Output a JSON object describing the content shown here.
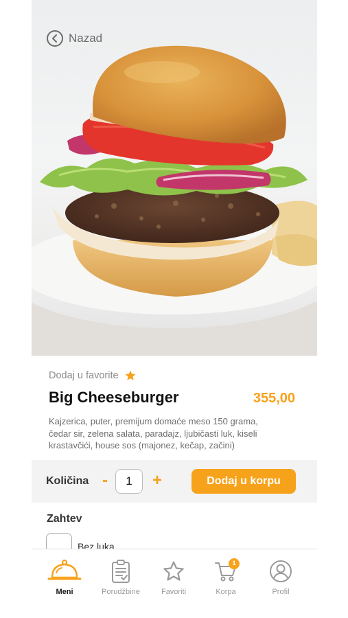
{
  "header": {
    "back_label": "Nazad"
  },
  "product": {
    "favorite_label": "Dodaj u favorite",
    "name": "Big Cheeseburger",
    "price": "355,00",
    "description": "Kajzerica, puter, premijum domaće meso 150 grama, čedar sir, zelena salata, paradajz, ljubičasti luk, kiseli krastavčići, house sos (majonez, kečap, začini)"
  },
  "quantity": {
    "label": "Količina",
    "minus": "-",
    "value": "1",
    "plus": "+",
    "add_button": "Dodaj u korpu"
  },
  "requests": {
    "title": "Zahtev",
    "options": [
      {
        "label": "Bez luka"
      }
    ]
  },
  "nav": {
    "items": [
      {
        "label": "Meni",
        "icon": "cloche-icon",
        "active": true
      },
      {
        "label": "Porudžbine",
        "icon": "clipboard-icon"
      },
      {
        "label": "Favoriti",
        "icon": "star-icon"
      },
      {
        "label": "Korpa",
        "icon": "cart-icon",
        "badge": "1"
      },
      {
        "label": "Profil",
        "icon": "user-icon"
      }
    ]
  },
  "colors": {
    "accent": "#f7a21b",
    "text": "#111111",
    "muted": "#8a8a8a"
  }
}
